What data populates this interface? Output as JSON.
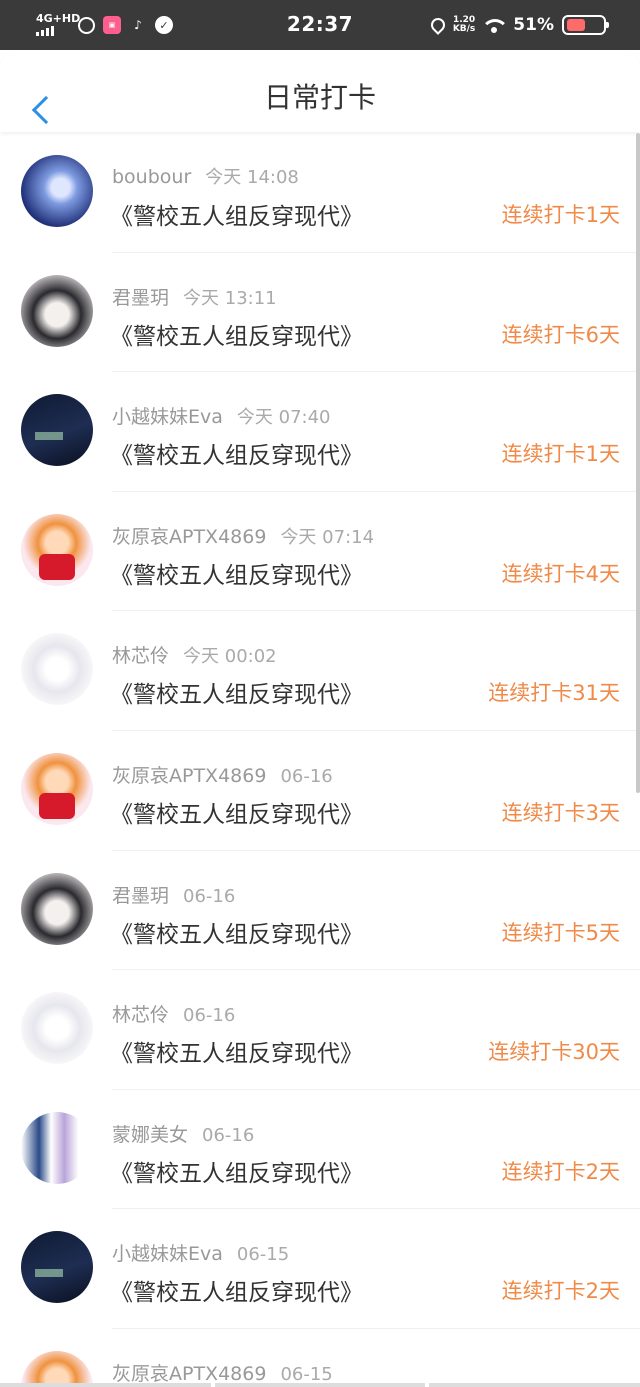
{
  "status_bar": {
    "network": "4G+HD",
    "time": "22:37",
    "speed_value": "1.20",
    "speed_unit": "KB/s",
    "battery": "51%",
    "icons": [
      "signal-icon",
      "app-icon",
      "bilibili-icon",
      "tiktok-icon",
      "check-icon",
      "location-icon",
      "wifi-icon",
      "battery-icon"
    ]
  },
  "header": {
    "title": "日常打卡",
    "back_icon": "chevron-left-icon"
  },
  "colors": {
    "accent": "#2b8fe6",
    "streak": "#ef8a48",
    "name": "#999999",
    "text": "#333333"
  },
  "checkins": [
    {
      "user": "boubour",
      "time": "今天 14:08",
      "book": "《警校五人组反穿现代》",
      "streak": "连续打卡1天",
      "avatar": "av-a"
    },
    {
      "user": "君墨玥",
      "time": "今天 13:11",
      "book": "《警校五人组反穿现代》",
      "streak": "连续打卡6天",
      "avatar": "av-b"
    },
    {
      "user": "小越妹妹Eva",
      "time": "今天 07:40",
      "book": "《警校五人组反穿现代》",
      "streak": "连续打卡1天",
      "avatar": "av-c"
    },
    {
      "user": "灰原哀APTX4869",
      "time": "今天 07:14",
      "book": "《警校五人组反穿现代》",
      "streak": "连续打卡4天",
      "avatar": "av-d"
    },
    {
      "user": "林芯伶",
      "time": "今天 00:02",
      "book": "《警校五人组反穿现代》",
      "streak": "连续打卡31天",
      "avatar": "av-e"
    },
    {
      "user": "灰原哀APTX4869",
      "time": "06-16",
      "book": "《警校五人组反穿现代》",
      "streak": "连续打卡3天",
      "avatar": "av-d"
    },
    {
      "user": "君墨玥",
      "time": "06-16",
      "book": "《警校五人组反穿现代》",
      "streak": "连续打卡5天",
      "avatar": "av-b"
    },
    {
      "user": "林芯伶",
      "time": "06-16",
      "book": "《警校五人组反穿现代》",
      "streak": "连续打卡30天",
      "avatar": "av-e"
    },
    {
      "user": "蒙娜美女",
      "time": "06-16",
      "book": "《警校五人组反穿现代》",
      "streak": "连续打卡2天",
      "avatar": "av-f"
    },
    {
      "user": "小越妹妹Eva",
      "time": "06-15",
      "book": "《警校五人组反穿现代》",
      "streak": "连续打卡2天",
      "avatar": "av-c"
    },
    {
      "user": "灰原哀APTX4869",
      "time": "06-15",
      "book": "",
      "streak": "",
      "avatar": "av-d"
    }
  ]
}
